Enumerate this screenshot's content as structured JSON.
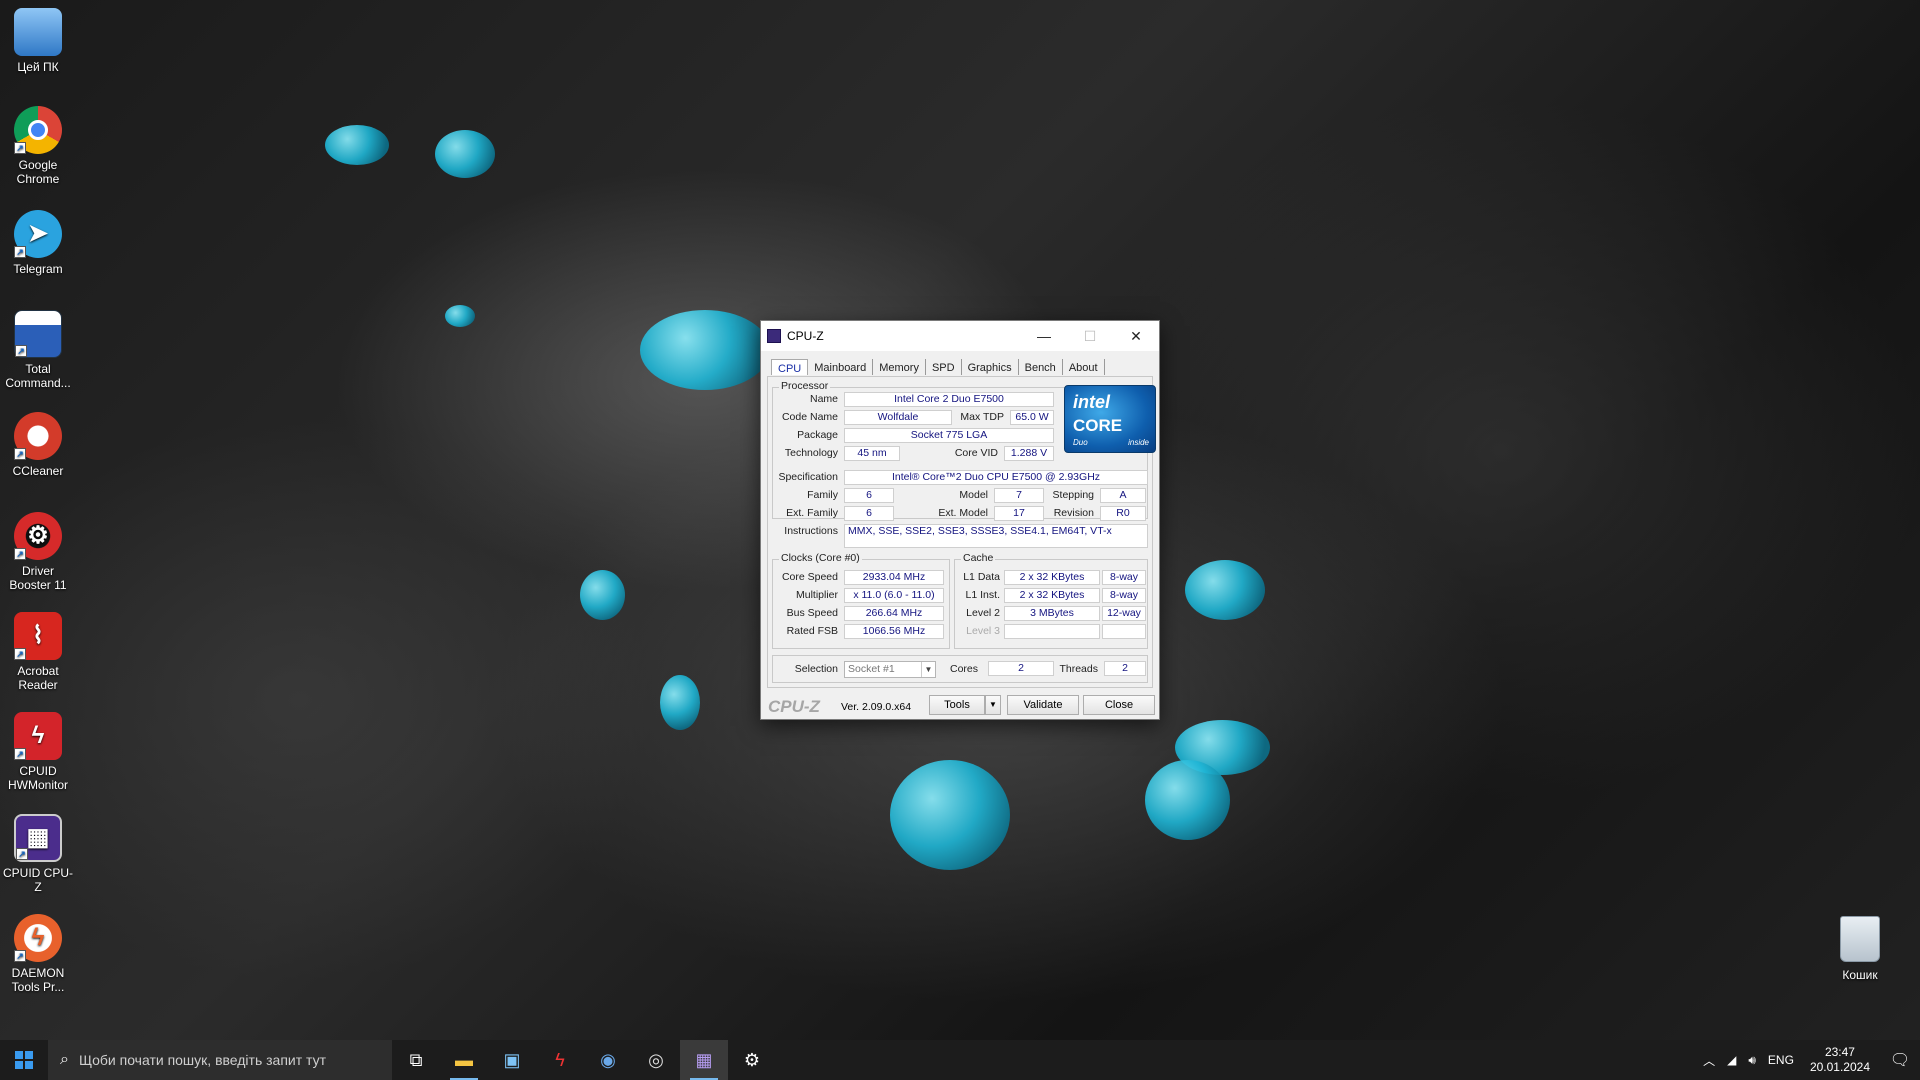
{
  "desktop": {
    "icons": [
      {
        "label": "Цей ПК",
        "icon": "computer-icon",
        "color": "#4a8fd8"
      },
      {
        "label": "Google Chrome",
        "icon": "chrome-icon",
        "color": "#e0463a"
      },
      {
        "label": "Telegram",
        "icon": "telegram-icon",
        "color": "#2aa3df"
      },
      {
        "label": "Total Command...",
        "icon": "total-commander-icon",
        "color": "#2b5fb8"
      },
      {
        "label": "CCleaner",
        "icon": "ccleaner-icon",
        "color": "#d33b2a"
      },
      {
        "label": "Driver Booster 11",
        "icon": "driver-booster-icon",
        "color": "#d62a2a"
      },
      {
        "label": "Acrobat Reader",
        "icon": "acrobat-icon",
        "color": "#d7261f"
      },
      {
        "label": "CPUID HWMonitor",
        "icon": "hwmonitor-icon",
        "color": "#d3242a"
      },
      {
        "label": "CPUID CPU-Z",
        "icon": "cpuz-icon",
        "color": "#4b2d8c"
      },
      {
        "label": "DAEMON Tools Pr...",
        "icon": "daemon-tools-icon",
        "color": "#e8612c"
      }
    ],
    "recycle_bin": "Кошик"
  },
  "cpuz": {
    "title": "CPU-Z",
    "tabs": [
      "CPU",
      "Mainboard",
      "Memory",
      "SPD",
      "Graphics",
      "Bench",
      "About"
    ],
    "active_tab": "CPU",
    "processor": {
      "group": "Processor",
      "name_label": "Name",
      "name": "Intel Core 2 Duo E7500",
      "codename_label": "Code Name",
      "codename": "Wolfdale",
      "maxtdp_label": "Max TDP",
      "maxtdp": "65.0 W",
      "package_label": "Package",
      "package": "Socket 775 LGA",
      "technology_label": "Technology",
      "technology": "45 nm",
      "corevid_label": "Core VID",
      "corevid": "1.288 V",
      "spec_label": "Specification",
      "spec": "Intel® Core™2 Duo CPU     E7500  @ 2.93GHz",
      "family_label": "Family",
      "family": "6",
      "model_label": "Model",
      "model": "7",
      "stepping_label": "Stepping",
      "stepping": "A",
      "extfamily_label": "Ext. Family",
      "extfamily": "6",
      "extmodel_label": "Ext. Model",
      "extmodel": "17",
      "revision_label": "Revision",
      "revision": "R0",
      "instructions_label": "Instructions",
      "instructions": "MMX, SSE, SSE2, SSE3, SSSE3, SSE4.1, EM64T, VT-x"
    },
    "logo": {
      "line1": "intel",
      "line2": "CORE",
      "line3": "Duo",
      "line4": "inside"
    },
    "clocks": {
      "group": "Clocks (Core #0)",
      "corespeed_label": "Core Speed",
      "corespeed": "2933.04 MHz",
      "multiplier_label": "Multiplier",
      "multiplier": "x 11.0 (6.0 - 11.0)",
      "busspeed_label": "Bus Speed",
      "busspeed": "266.64 MHz",
      "ratedfsb_label": "Rated FSB",
      "ratedfsb": "1066.56 MHz"
    },
    "cache": {
      "group": "Cache",
      "l1d_label": "L1 Data",
      "l1d": "2 x 32 KBytes",
      "l1d_way": "8-way",
      "l1i_label": "L1 Inst.",
      "l1i": "2 x 32 KBytes",
      "l1i_way": "8-way",
      "l2_label": "Level 2",
      "l2": "3 MBytes",
      "l2_way": "12-way",
      "l3_label": "Level 3"
    },
    "selection_label": "Selection",
    "selection": "Socket #1",
    "cores_label": "Cores",
    "cores": "2",
    "threads_label": "Threads",
    "threads": "2",
    "brand": "CPU-Z",
    "version": "Ver. 2.09.0.x64",
    "tools": "Tools",
    "validate": "Validate",
    "close": "Close"
  },
  "taskbar": {
    "search_placeholder": "Щоби почати пошук, введіть запит тут",
    "lang": "ENG",
    "time": "23:47",
    "date": "20.01.2024"
  }
}
